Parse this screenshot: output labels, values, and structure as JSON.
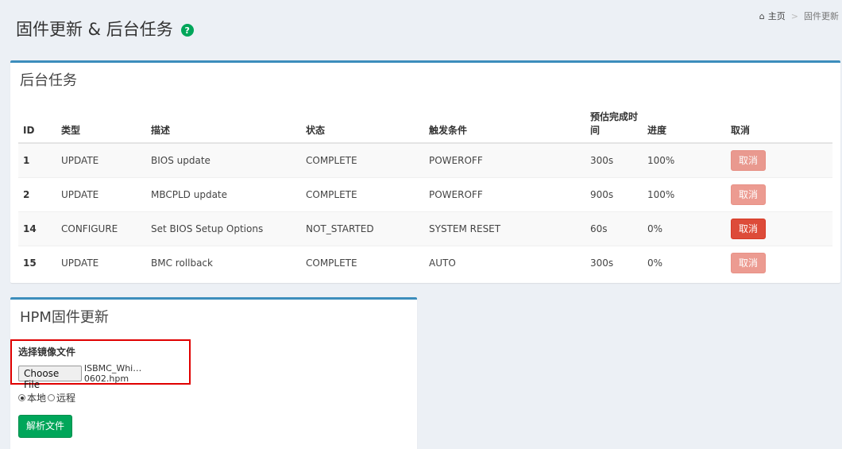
{
  "header": {
    "title": "固件更新 & 后台任务",
    "help_icon": "?"
  },
  "breadcrumb": {
    "home_label": "主页",
    "separator": ">",
    "current": "固件更新"
  },
  "tasks_box": {
    "title": "后台任务",
    "columns": [
      "ID",
      "类型",
      "描述",
      "状态",
      "触发条件",
      "预估完成时间",
      "进度",
      "取消"
    ],
    "rows": [
      {
        "id": "1",
        "type": "UPDATE",
        "desc": "BIOS update",
        "status": "COMPLETE",
        "trigger": "POWEROFF",
        "eta": "300s",
        "progress": "100%",
        "cancel": "取消",
        "cancel_enabled": false
      },
      {
        "id": "2",
        "type": "UPDATE",
        "desc": "MBCPLD update",
        "status": "COMPLETE",
        "trigger": "POWEROFF",
        "eta": "900s",
        "progress": "100%",
        "cancel": "取消",
        "cancel_enabled": false
      },
      {
        "id": "14",
        "type": "CONFIGURE",
        "desc": "Set BIOS Setup Options",
        "status": "NOT_STARTED",
        "trigger": "SYSTEM RESET",
        "eta": "60s",
        "progress": "0%",
        "cancel": "取消",
        "cancel_enabled": true
      },
      {
        "id": "15",
        "type": "UPDATE",
        "desc": "BMC rollback",
        "status": "COMPLETE",
        "trigger": "AUTO",
        "eta": "300s",
        "progress": "0%",
        "cancel": "取消",
        "cancel_enabled": false
      }
    ]
  },
  "hpm_box": {
    "title": "HPM固件更新",
    "file_label": "选择镜像文件",
    "choose_button": "Choose File",
    "file_name": "ISBMC_Whi…0602.hpm",
    "radio_local": "本地",
    "radio_remote": "远程",
    "parse_button": "解析文件"
  },
  "colors": {
    "accent": "#3c8dbc",
    "danger": "#dd4b39",
    "success": "#00a65a"
  }
}
